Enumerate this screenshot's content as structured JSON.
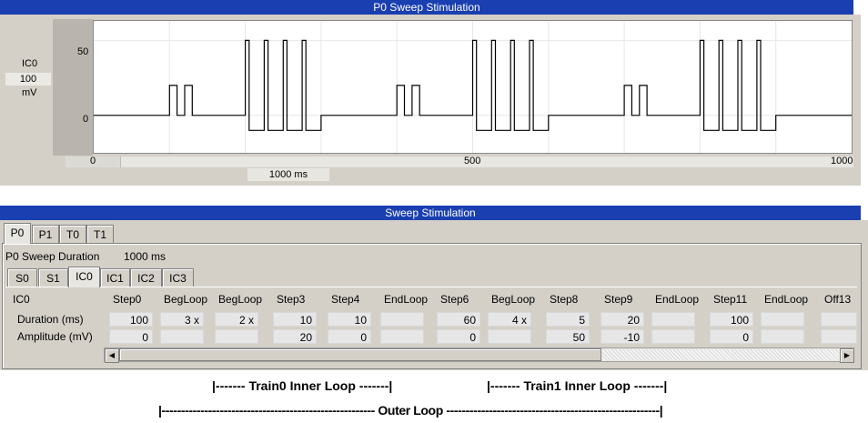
{
  "chart_window": {
    "title": "P0 Sweep Stimulation",
    "channel_label": "IC0",
    "scale_value": "100",
    "scale_unit": "mV",
    "y_ticks": [
      "50",
      "0"
    ],
    "x_ticks": [
      "0",
      "500",
      "1000"
    ],
    "duration_box": "1000 ms"
  },
  "chart_data": {
    "type": "line",
    "xlabel": "",
    "ylabel": "",
    "xlim": [
      0,
      1000
    ],
    "ylim": [
      -25,
      63
    ],
    "y_tick_values": [
      0,
      50
    ],
    "x_tick_values": [
      0,
      500,
      1000
    ],
    "grid": true,
    "series": [
      {
        "points": [
          [
            0,
            0
          ],
          [
            100,
            0
          ],
          [
            100,
            20
          ],
          [
            110,
            20
          ],
          [
            110,
            0
          ],
          [
            120,
            0
          ],
          [
            120,
            20
          ],
          [
            130,
            20
          ],
          [
            130,
            0
          ],
          [
            200,
            0
          ],
          [
            200,
            50
          ],
          [
            205,
            50
          ],
          [
            205,
            -10
          ],
          [
            225,
            -10
          ],
          [
            225,
            50
          ],
          [
            230,
            50
          ],
          [
            230,
            -10
          ],
          [
            250,
            -10
          ],
          [
            250,
            50
          ],
          [
            255,
            50
          ],
          [
            255,
            -10
          ],
          [
            275,
            -10
          ],
          [
            275,
            50
          ],
          [
            280,
            50
          ],
          [
            280,
            -10
          ],
          [
            300,
            -10
          ],
          [
            300,
            0
          ],
          [
            400,
            0
          ],
          [
            400,
            20
          ],
          [
            410,
            20
          ],
          [
            410,
            0
          ],
          [
            420,
            0
          ],
          [
            420,
            20
          ],
          [
            430,
            20
          ],
          [
            430,
            0
          ],
          [
            500,
            0
          ],
          [
            500,
            50
          ],
          [
            505,
            50
          ],
          [
            505,
            -10
          ],
          [
            525,
            -10
          ],
          [
            525,
            50
          ],
          [
            530,
            50
          ],
          [
            530,
            -10
          ],
          [
            550,
            -10
          ],
          [
            550,
            50
          ],
          [
            555,
            50
          ],
          [
            555,
            -10
          ],
          [
            575,
            -10
          ],
          [
            575,
            50
          ],
          [
            580,
            50
          ],
          [
            580,
            -10
          ],
          [
            600,
            -10
          ],
          [
            600,
            0
          ],
          [
            700,
            0
          ],
          [
            700,
            20
          ],
          [
            710,
            20
          ],
          [
            710,
            0
          ],
          [
            720,
            0
          ],
          [
            720,
            20
          ],
          [
            730,
            20
          ],
          [
            730,
            0
          ],
          [
            800,
            0
          ],
          [
            800,
            50
          ],
          [
            805,
            50
          ],
          [
            805,
            -10
          ],
          [
            825,
            -10
          ],
          [
            825,
            50
          ],
          [
            830,
            50
          ],
          [
            830,
            -10
          ],
          [
            850,
            -10
          ],
          [
            850,
            50
          ],
          [
            855,
            50
          ],
          [
            855,
            -10
          ],
          [
            875,
            -10
          ],
          [
            875,
            50
          ],
          [
            880,
            50
          ],
          [
            880,
            -10
          ],
          [
            900,
            -10
          ],
          [
            900,
            0
          ],
          [
            1000,
            0
          ]
        ]
      }
    ]
  },
  "sweep_window": {
    "title": "Sweep Stimulation",
    "outer_tabs": [
      "P0",
      "P1",
      "T0",
      "T1"
    ],
    "active_outer_tab": "P0",
    "duration_label": "P0 Sweep Duration",
    "duration_value": "1000 ms",
    "inner_tabs": [
      "S0",
      "S1",
      "IC0",
      "IC1",
      "IC2",
      "IC3"
    ],
    "active_inner_tab": "IC0",
    "table": {
      "corner_label": "IC0",
      "headers": [
        "Step0",
        "BegLoop",
        "BegLoop",
        "Step3",
        "Step4",
        "EndLoop",
        "Step6",
        "BegLoop",
        "Step8",
        "Step9",
        "EndLoop",
        "Step11",
        "EndLoop",
        "Off13"
      ],
      "rows": [
        {
          "label": "Duration (ms)",
          "cells": [
            "100",
            "3 x",
            "2 x",
            "10",
            "10",
            "",
            "60",
            "4 x",
            "5",
            "20",
            "",
            "100",
            "",
            ""
          ]
        },
        {
          "label": "Amplitude (mV)",
          "cells": [
            "0",
            "",
            "",
            "20",
            "0",
            "",
            "0",
            "",
            "50",
            "-10",
            "",
            "0",
            "",
            ""
          ]
        }
      ]
    }
  },
  "annotations": {
    "train0": "|------- Train0 Inner Loop -------|",
    "train1": "|------- Train1 Inner Loop -------|",
    "outer": "|------------------------------------------------------- Outer Loop -------------------------------------------------------|"
  }
}
